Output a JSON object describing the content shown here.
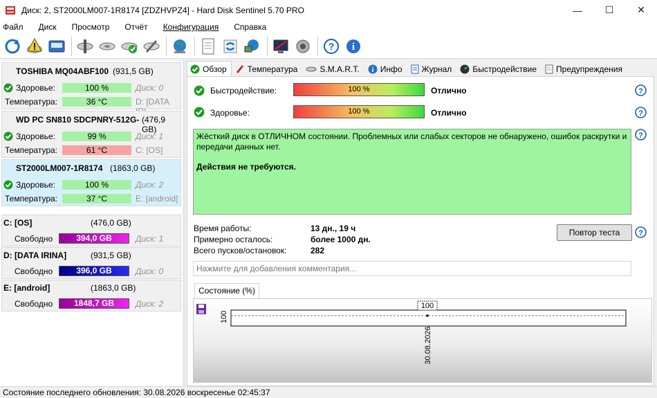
{
  "window": {
    "title": "Диск: 2, ST2000LM007-1R8174 [ZDZHVPZ4]  -  Hard Disk Sentinel 5.70 PRO",
    "minimize": "—",
    "maximize": "☐",
    "close": "✕"
  },
  "menu": [
    "Файл",
    "Диск",
    "Просмотр",
    "Отчёт",
    "Конфигурация",
    "Справка"
  ],
  "toolbar_icons": [
    "refresh-icon",
    "warning-icon",
    "disk-icon",
    "disk-tool-icon",
    "disk-gray-icon",
    "disk-check-icon",
    "disk-wrench-icon",
    "globe-icon",
    "report-icon",
    "sync-icon",
    "network-icon",
    "monitor-icon",
    "speaker-icon",
    "help-icon",
    "info-icon"
  ],
  "disks": [
    {
      "name": "TOSHIBA MQ04ABF100",
      "size": "(931,5 GB)",
      "health_label": "Здоровье:",
      "health": "100 %",
      "health_pct": 100,
      "disk_ref": "Диск: 0",
      "temp_label": "Температура:",
      "temp": "36 °C",
      "temp_status": "green",
      "vol_ref": "D: [DATA IRI"
    },
    {
      "name": "WD PC SN810 SDCPNRY-512G-",
      "size": "(476,9 GB)",
      "health_label": "Здоровье:",
      "health": "99 %",
      "health_pct": 99,
      "disk_ref": "Диск: 1",
      "temp_label": "Температура:",
      "temp": "61 °C",
      "temp_status": "red",
      "vol_ref": "C: [OS]"
    },
    {
      "name": "ST2000LM007-1R8174",
      "size": "(1863,0 GB)",
      "health_label": "Здоровье:",
      "health": "100 %",
      "health_pct": 100,
      "disk_ref": "Диск: 2",
      "temp_label": "Температура:",
      "temp": "37 °C",
      "temp_status": "green",
      "vol_ref": "E: [android]"
    }
  ],
  "volumes": [
    {
      "name": "C: [OS]",
      "size": "(476,0 GB)",
      "free_label": "Свободно",
      "free": "394,0 GB",
      "color": "#cc00cc",
      "disk_ref": "Диск: 1"
    },
    {
      "name": "D: [DATA IRINA]",
      "size": "(931,5 GB)",
      "free_label": "Свободно",
      "free": "396,0 GB",
      "color": "#0000cc",
      "disk_ref": "Диск: 0"
    },
    {
      "name": "E: [android]",
      "size": "(1863,0 GB)",
      "free_label": "Свободно",
      "free": "1848,7 GB",
      "color": "#cc00cc",
      "disk_ref": "Диск: 2"
    }
  ],
  "tabs": [
    "Обзор",
    "Температура",
    "S.M.A.R.T.",
    "Инфо",
    "Журнал",
    "Быстродействие",
    "Предупреждения"
  ],
  "overview": {
    "performance_label": "Быстродействие:",
    "performance_value": "100 %",
    "performance_pct": 100,
    "performance_rating": "Отлично",
    "health_label": "Здоровье:",
    "health_value": "100 %",
    "health_pct": 100,
    "health_rating": "Отлично",
    "status_text": "Жёсткий диск в ОТЛИЧНОМ состоянии. Проблемных или слабых секторов не обнаружено, ошибок раскрутки и передачи данных нет.",
    "action_text": "Действия не требуются.",
    "uptime_label": "Время работы:",
    "uptime_value": "13 дн., 19 ч",
    "remaining_label": "Примерно осталось:",
    "remaining_value": "более 1000 дн.",
    "starts_label": "Всего пусков/остановок:",
    "starts_value": "282",
    "retest_button": "Повтор теста",
    "comment_placeholder": "Нажмите для добавления комментария..."
  },
  "chart_tab": "Состояние (%)",
  "chart_data": {
    "type": "line",
    "x": [
      "30.08.2026"
    ],
    "values": [
      100
    ],
    "ylabel": "",
    "y_tick": "100",
    "data_label": "100"
  },
  "statusbar": "Состояние последнего обновления: 30.08.2026 воскресенье 02:45:37"
}
